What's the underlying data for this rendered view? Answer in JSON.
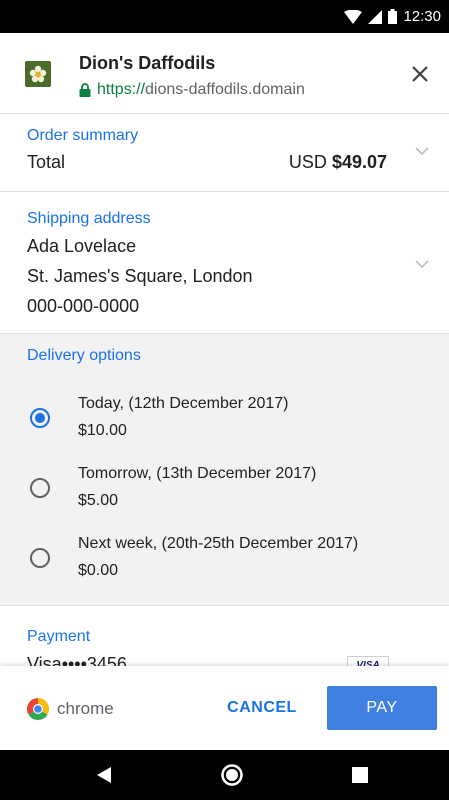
{
  "status_bar": {
    "time": "12:30"
  },
  "merchant": {
    "name": "Dion's Daffodils",
    "url_scheme": "https://",
    "url_host": "dions-daffodils.domain",
    "logo_icon": "daffodil-flower-icon"
  },
  "order_summary": {
    "title": "Order summary",
    "label": "Total",
    "currency": "USD",
    "amount": "$49.07"
  },
  "shipping": {
    "title": "Shipping address",
    "name": "Ada Lovelace",
    "address": "St. James's Square, London",
    "phone": "000-000-0000"
  },
  "delivery": {
    "title": "Delivery options",
    "options": [
      {
        "label": "Today, (12th December 2017)",
        "price": "$10.00",
        "selected": true
      },
      {
        "label": "Tomorrow, (13th December 2017)",
        "price": "$5.00",
        "selected": false
      },
      {
        "label": "Next week, (20th-25th December 2017)",
        "price": "$0.00",
        "selected": false
      }
    ]
  },
  "payment": {
    "title": "Payment",
    "card": "Visa••••3456",
    "card_brand": "VISA"
  },
  "footer": {
    "brand": "chrome",
    "cancel_label": "CANCEL",
    "pay_label": "PAY"
  },
  "colors": {
    "accent": "#1a73e8",
    "pay_button": "#3f80e0",
    "secure_green": "#0b8043"
  }
}
